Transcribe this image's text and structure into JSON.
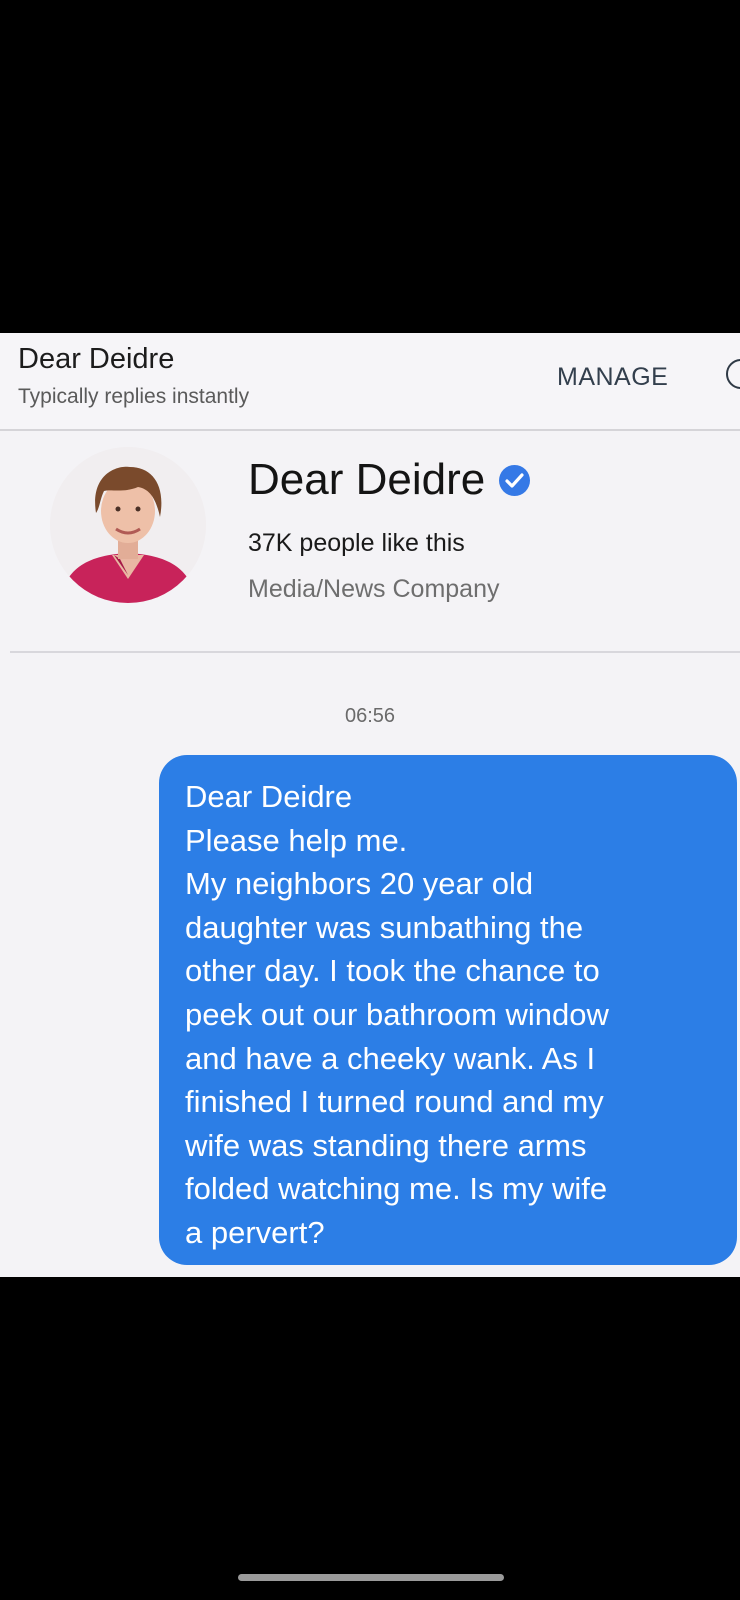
{
  "header": {
    "title": "Dear Deidre",
    "subtitle": "Typically replies instantly",
    "manage_label": "MANAGE"
  },
  "profile": {
    "name": "Dear Deidre",
    "likes": "37K people like this",
    "category": "Media/News Company",
    "avatar_icon": "person-portrait-icon",
    "verified_icon": "verified-check-icon"
  },
  "conversation": {
    "timestamp": "06:56",
    "message_lines": [
      "Dear Deidre",
      "Please help me.",
      "My neighbors 20 year old",
      "daughter was sunbathing the",
      "other day. I took the chance to",
      "peek out our bathroom window",
      "and have a cheeky wank. As I",
      "finished I turned round and my",
      "wife was standing there arms",
      "folded watching me. Is my wife",
      "a pervert?"
    ]
  },
  "colors": {
    "bubble": "#2c7ee6",
    "verified": "#3579e6",
    "background": "#f4f3f6"
  }
}
